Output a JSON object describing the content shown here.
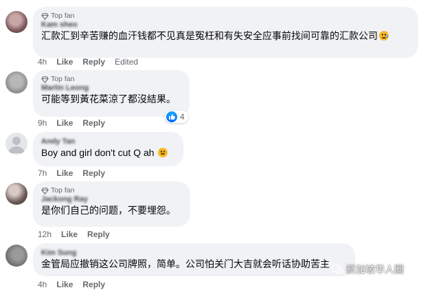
{
  "comments": [
    {
      "badge": "Top fan",
      "name": "Kam sheo",
      "text": "汇款汇到辛苦赚的血汗钱都不见真是冤枉和有失安全应事前找间可靠的汇款公司",
      "emoji": "sad-face-emoji",
      "time": "4h",
      "like_label": "Like",
      "reply_label": "Reply",
      "edited_label": "Edited"
    },
    {
      "badge": "Top fan",
      "name": "Martin Leong",
      "text": "可能等到黃花菜涼了都沒結果。",
      "time": "9h",
      "like_label": "Like",
      "reply_label": "Reply",
      "reaction_count": "4"
    },
    {
      "name": "Andy Tan",
      "text": "Boy and girl don't cut Q ah",
      "emoji": "grinning-face-emoji",
      "time": "7h",
      "like_label": "Like",
      "reply_label": "Reply"
    },
    {
      "badge": "Top fan",
      "name": "Jackong Ray",
      "text": "是你们自己的问题，不要埋怨。",
      "time": "12h",
      "like_label": "Like",
      "reply_label": "Reply"
    },
    {
      "name": "Kim Sung",
      "text": "金管局应撤销这公司牌照，简单。公司怕关门大吉就会听话协助苦主",
      "time": "4h",
      "like_label": "Like",
      "reply_label": "Reply"
    }
  ],
  "watermark": "新加坡华人圈",
  "colors": {
    "bubble": "#f0f2f5",
    "muted": "#65676b",
    "like_blue": "#0866ff"
  }
}
